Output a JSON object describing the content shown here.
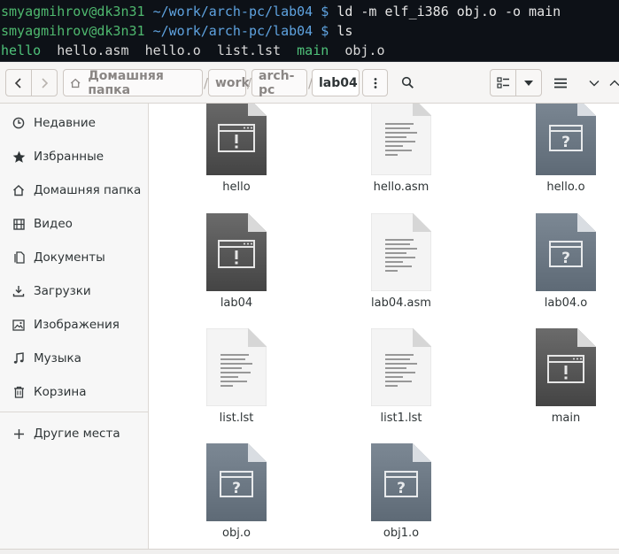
{
  "terminal": {
    "line1": {
      "user": "smyagmihrov@dk3n31",
      "path": "~/work/arch-pc/lab04",
      "prompt": "$",
      "command": "ld -m elf_i386 obj.o -o main"
    },
    "line2": {
      "user": "smyagmihrov@dk3n31",
      "path": "~/work/arch-pc/lab04",
      "prompt": "$",
      "command": "ls"
    },
    "line3": [
      {
        "name": "hello",
        "kind": "exec"
      },
      {
        "name": "hello.asm",
        "kind": "file"
      },
      {
        "name": "hello.o",
        "kind": "file"
      },
      {
        "name": "list.lst",
        "kind": "file"
      },
      {
        "name": "main",
        "kind": "exec"
      },
      {
        "name": "obj.o",
        "kind": "file"
      }
    ]
  },
  "toolbar": {
    "breadcrumbs": [
      {
        "label": "Домашняя папка",
        "icon": "home-icon"
      },
      {
        "label": "work"
      },
      {
        "label": "arch-pc"
      },
      {
        "label": "lab04",
        "active": true
      }
    ]
  },
  "sidebar": {
    "items": [
      {
        "label": "Недавние",
        "icon": "clock-icon"
      },
      {
        "label": "Избранные",
        "icon": "star-icon"
      },
      {
        "label": "Домашняя папка",
        "icon": "home-icon"
      },
      {
        "label": "Видео",
        "icon": "video-icon"
      },
      {
        "label": "Документы",
        "icon": "document-icon"
      },
      {
        "label": "Загрузки",
        "icon": "download-icon"
      },
      {
        "label": "Изображения",
        "icon": "image-icon"
      },
      {
        "label": "Музыка",
        "icon": "music-icon"
      },
      {
        "label": "Корзина",
        "icon": "trash-icon"
      },
      {
        "label": "Другие места",
        "icon": "plus-icon"
      }
    ]
  },
  "files": [
    {
      "name": "hello",
      "type": "executable"
    },
    {
      "name": "hello.asm",
      "type": "text"
    },
    {
      "name": "hello.o",
      "type": "unknown"
    },
    {
      "name": "lab04",
      "type": "executable"
    },
    {
      "name": "lab04.asm",
      "type": "text"
    },
    {
      "name": "lab04.o",
      "type": "unknown"
    },
    {
      "name": "list.lst",
      "type": "text"
    },
    {
      "name": "list1.lst",
      "type": "text"
    },
    {
      "name": "main",
      "type": "executable"
    },
    {
      "name": "obj.o",
      "type": "unknown"
    },
    {
      "name": "obj1.o",
      "type": "unknown"
    }
  ],
  "colors": {
    "terminal_bg": "#0d1117",
    "terminal_user": "#4fb96f",
    "terminal_path": "#5fa3e0",
    "exec_icon": "#5a5a5a",
    "unknown_icon": "#6e7a86"
  }
}
